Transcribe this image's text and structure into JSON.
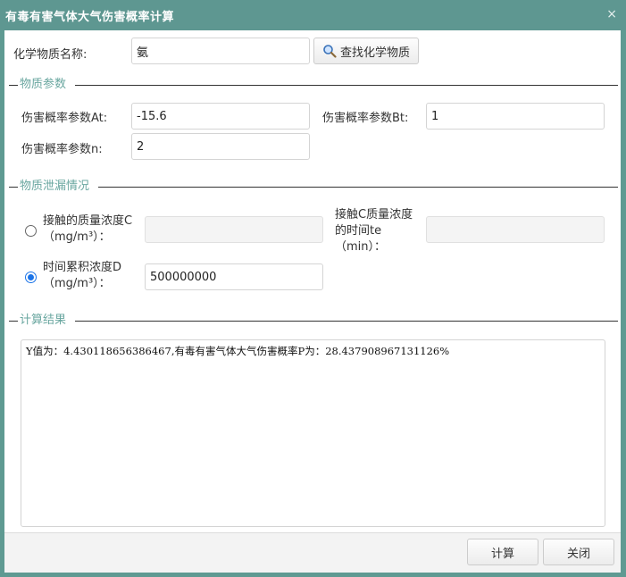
{
  "window": {
    "title": "有毒有害气体大气伤害概率计算",
    "close_glyph": "×"
  },
  "chemical": {
    "name_label": "化学物质名称:",
    "name_value": "氨",
    "search_button_label": "查找化学物质"
  },
  "params_section": {
    "title": "物质参数",
    "at_label": "伤害概率参数At:",
    "at_value": "-15.6",
    "bt_label": "伤害概率参数Bt:",
    "bt_value": "1",
    "n_label": "伤害概率参数n:",
    "n_value": "2"
  },
  "leak_section": {
    "title": "物质泄漏情况",
    "option_c": {
      "label_line1": "接触的质量浓度C",
      "label_line2": "（mg/m³）：",
      "value": "",
      "selected": false
    },
    "te": {
      "label_line1": "接触C质量浓度",
      "label_line2": "的时间te",
      "label_line3": "（min）：",
      "value": ""
    },
    "option_d": {
      "label_line1": "时间累积浓度D",
      "label_line2": "（mg/m³）：",
      "value": "500000000",
      "selected": true
    }
  },
  "result_section": {
    "title": "计算结果",
    "text": "Y值为：4.430118656386467,有毒有害气体大气伤害概率P为：28.437908967131126%"
  },
  "footer": {
    "calculate_label": "计算",
    "close_label": "关闭"
  },
  "colors": {
    "title_bar": "#5e9791",
    "section_title": "#6aa7a0",
    "radio_selected": "#1a73e8"
  },
  "icons": {
    "search": "magnifier-icon",
    "close": "close-icon"
  }
}
